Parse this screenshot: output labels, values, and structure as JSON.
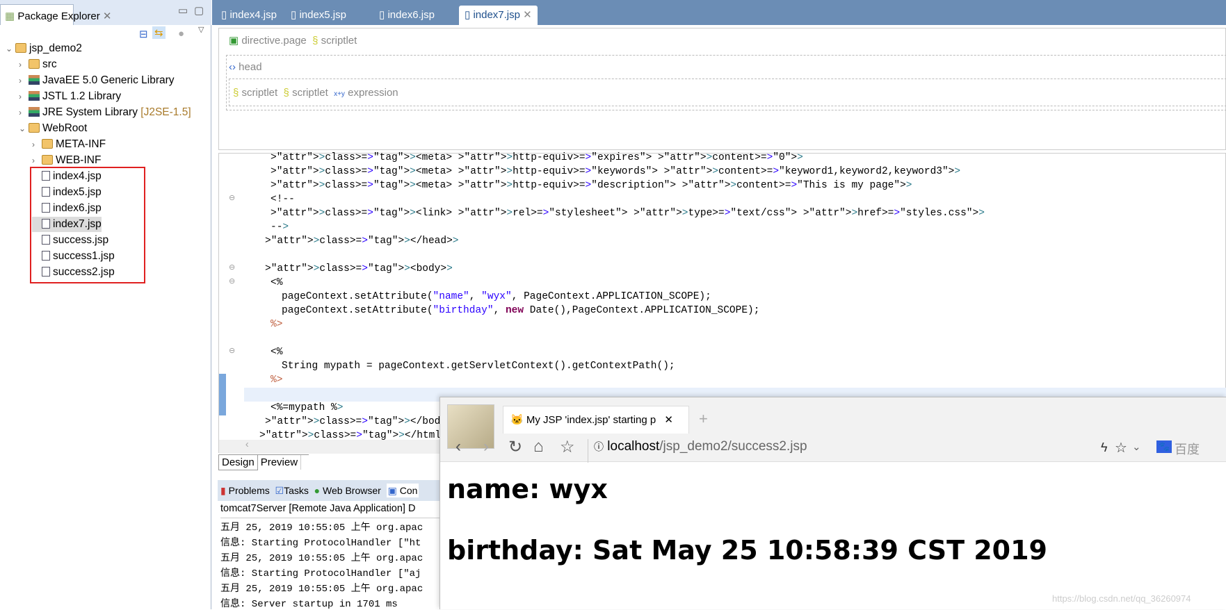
{
  "package_explorer": {
    "title": "Package Explorer",
    "tree": [
      {
        "label": "jsp_demo2",
        "level": 0,
        "icon": "project-icon",
        "expanded": true
      },
      {
        "label": "src",
        "level": 1,
        "icon": "package-folder-icon"
      },
      {
        "label": "JavaEE 5.0 Generic Library",
        "level": 1,
        "icon": "library-icon"
      },
      {
        "label": "JSTL 1.2 Library",
        "level": 1,
        "icon": "library-icon"
      },
      {
        "label": "JRE System Library",
        "suffix": "[J2SE-1.5]",
        "level": 1,
        "icon": "library-icon"
      },
      {
        "label": "WebRoot",
        "level": 1,
        "icon": "folder-icon",
        "expanded": true
      },
      {
        "label": "META-INF",
        "level": 2,
        "icon": "folder-icon"
      },
      {
        "label": "WEB-INF",
        "level": 2,
        "icon": "folder-icon"
      },
      {
        "label": "index4.jsp",
        "level": 2,
        "icon": "jsp-file-icon"
      },
      {
        "label": "index5.jsp",
        "level": 2,
        "icon": "jsp-file-icon"
      },
      {
        "label": "index6.jsp",
        "level": 2,
        "icon": "jsp-file-icon"
      },
      {
        "label": "index7.jsp",
        "level": 2,
        "icon": "jsp-file-icon",
        "selected": true
      },
      {
        "label": "success.jsp",
        "level": 2,
        "icon": "jsp-file-icon"
      },
      {
        "label": "success1.jsp",
        "level": 2,
        "icon": "jsp-file-icon"
      },
      {
        "label": "success2.jsp",
        "level": 2,
        "icon": "jsp-file-icon"
      }
    ]
  },
  "editor": {
    "tabs": [
      "index4.jsp",
      "index5.jsp",
      "index6.jsp",
      "index7.jsp"
    ],
    "active_tab": "index7.jsp",
    "design": {
      "row1": [
        "directive.page",
        "scriptlet"
      ],
      "head": "head",
      "row2": [
        "scriptlet",
        "scriptlet",
        "expression"
      ]
    },
    "code_lines": [
      "<meta http-equiv=\"expires\" content=\"0\">",
      "<meta http-equiv=\"keywords\" content=\"keyword1,keyword2,keyword3\">",
      "<meta http-equiv=\"description\" content=\"This is my page\">",
      "<!--",
      "<link rel=\"stylesheet\" type=\"text/css\" href=\"styles.css\">",
      "-->",
      "</head>",
      "",
      "<body>",
      "<%",
      "pageContext.setAttribute(\"name\", \"wyx\", PageContext.APPLICATION_SCOPE);",
      "pageContext.setAttribute(\"birthday\", new Date(),PageContext.APPLICATION_SCOPE);",
      "%>",
      "",
      "<%",
      "String mypath = pageContext.getServletContext().getContextPath();",
      "%>",
      "",
      "<%=mypath %>",
      "</body>",
      "</html>"
    ],
    "bottom_tabs": [
      "Design",
      "Preview"
    ]
  },
  "console": {
    "tabs": [
      "Problems",
      "Tasks",
      "Web Browser",
      "Con"
    ],
    "header": "tomcat7Server [Remote Java Application] D",
    "lines": [
      "五月 25, 2019 10:55:05 上午 org.apac",
      "信息: Starting ProtocolHandler [\"ht",
      "五月 25, 2019 10:55:05 上午 org.apac",
      "信息: Starting ProtocolHandler [\"aj",
      "五月 25, 2019 10:55:05 上午 org.apac",
      "信息: Server startup in 1701 ms"
    ]
  },
  "browser": {
    "tab_title": "My JSP 'index.jsp' starting p",
    "url_host": "localhost",
    "url_path": "/jsp_demo2/success2.jsp",
    "search_engine": "百度",
    "content": [
      "name: wyx",
      "birthday: Sat May 25 10:58:39 CST 2019"
    ],
    "watermark": "https://blog.csdn.net/qq_36260974"
  }
}
